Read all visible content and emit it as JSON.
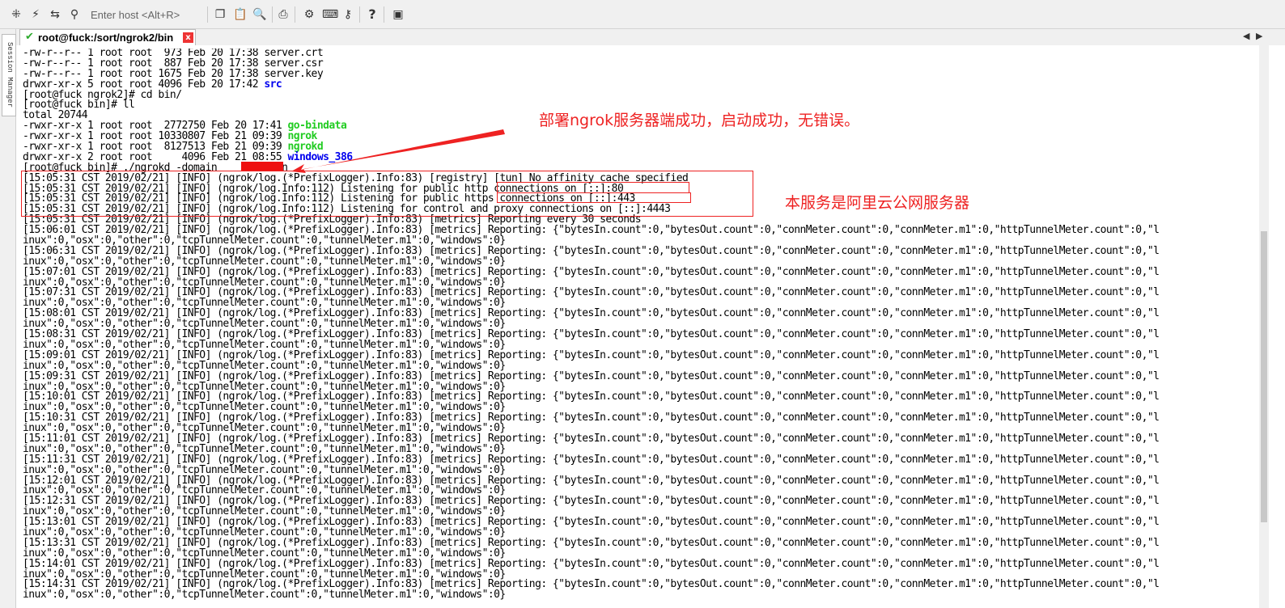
{
  "toolbar": {
    "host_placeholder": "Enter host <Alt+R>",
    "icons": [
      "session-tree-icon",
      "quick-connect-icon",
      "reconnect-icon",
      "connect-icon",
      "copy-icon",
      "paste-icon",
      "find-icon",
      "print-icon",
      "settings-icon",
      "keymap-icon",
      "sftp-icon",
      "help-icon",
      "screenshot-icon"
    ]
  },
  "tab": {
    "title": "root@fuck:/sort/ngrok2/bin",
    "close": "x"
  },
  "sidebar": {
    "label": "Session Manager"
  },
  "terminal": {
    "lines": [
      [
        {
          "t": "-rw-r--r-- 1 root root  973 Feb 20 17:38 server.crt"
        }
      ],
      [
        {
          "t": "-rw-r--r-- 1 root root  887 Feb 20 17:38 server.csr"
        }
      ],
      [
        {
          "t": "-rw-r--r-- 1 root root 1675 Feb 20 17:38 server.key"
        }
      ],
      [
        {
          "t": "drwxr-xr-x 5 root root 4096 Feb 20 17:42 "
        },
        {
          "t": "src",
          "c": "blue"
        }
      ],
      [
        {
          "t": "[root@fuck ngrok2]# cd bin/"
        }
      ],
      [
        {
          "t": "[root@fuck bin]# ll"
        }
      ],
      [
        {
          "t": "total 20744"
        }
      ],
      [
        {
          "t": "-rwxr-xr-x 1 root root  2772750 Feb 20 17:41 "
        },
        {
          "t": "go-bindata",
          "c": "green"
        }
      ],
      [
        {
          "t": "-rwxr-xr-x 1 root root 10330807 Feb 21 09:39 "
        },
        {
          "t": "ngrok",
          "c": "green"
        }
      ],
      [
        {
          "t": "-rwxr-xr-x 1 root root  8127513 Feb 21 09:39 "
        },
        {
          "t": "ngrokd",
          "c": "green"
        }
      ],
      [
        {
          "t": "drwxr-xr-x 2 root root     4096 Feb 21 08:55 "
        },
        {
          "t": "windows_386",
          "c": "blue"
        }
      ],
      [
        {
          "t": "[root@fuck bin]# ./ngrokd -domain         .cn"
        }
      ],
      [
        {
          "t": "[15:05:31 CST 2019/02/21] [INFO] (ngrok/log.(*PrefixLogger).Info:83) [registry] [tun] No affinity cache specified"
        }
      ],
      [
        {
          "t": "[15:05:31 CST 2019/02/21] [INFO] (ngrok/log.Info:112) Listening for public http connections on [::]:80"
        }
      ],
      [
        {
          "t": "[15:05:31 CST 2019/02/21] [INFO] (ngrok/log.Info:112) Listening for public https connections on [::]:443"
        }
      ],
      [
        {
          "t": "[15:05:31 CST 2019/02/21] [INFO] (ngrok/log.Info:112) Listening for control and proxy connections on [::]:4443"
        }
      ],
      [
        {
          "t": "[15:05:31 CST 2019/02/21] [INFO] (ngrok/log.(*PrefixLogger).Info:83) [metrics] Reporting every 30 seconds"
        }
      ],
      [
        {
          "t": "[15:06:01 CST 2019/02/21] [INFO] (ngrok/log.(*PrefixLogger).Info:83) [metrics] Reporting: {\"bytesIn.count\":0,\"bytesOut.count\":0,\"connMeter.count\":0,\"connMeter.m1\":0,\"httpTunnelMeter.count\":0,\"l"
        }
      ],
      [
        {
          "t": "inux\":0,\"osx\":0,\"other\":0,\"tcpTunnelMeter.count\":0,\"tunnelMeter.m1\":0,\"windows\":0}"
        }
      ],
      [
        {
          "t": "[15:06:31 CST 2019/02/21] [INFO] (ngrok/log.(*PrefixLogger).Info:83) [metrics] Reporting: {\"bytesIn.count\":0,\"bytesOut.count\":0,\"connMeter.count\":0,\"connMeter.m1\":0,\"httpTunnelMeter.count\":0,\"l"
        }
      ],
      [
        {
          "t": "inux\":0,\"osx\":0,\"other\":0,\"tcpTunnelMeter.count\":0,\"tunnelMeter.m1\":0,\"windows\":0}"
        }
      ],
      [
        {
          "t": "[15:07:01 CST 2019/02/21] [INFO] (ngrok/log.(*PrefixLogger).Info:83) [metrics] Reporting: {\"bytesIn.count\":0,\"bytesOut.count\":0,\"connMeter.count\":0,\"connMeter.m1\":0,\"httpTunnelMeter.count\":0,\"l"
        }
      ],
      [
        {
          "t": "inux\":0,\"osx\":0,\"other\":0,\"tcpTunnelMeter.count\":0,\"tunnelMeter.m1\":0,\"windows\":0}"
        }
      ],
      [
        {
          "t": "[15:07:31 CST 2019/02/21] [INFO] (ngrok/log.(*PrefixLogger).Info:83) [metrics] Reporting: {\"bytesIn.count\":0,\"bytesOut.count\":0,\"connMeter.count\":0,\"connMeter.m1\":0,\"httpTunnelMeter.count\":0,\"l"
        }
      ],
      [
        {
          "t": "inux\":0,\"osx\":0,\"other\":0,\"tcpTunnelMeter.count\":0,\"tunnelMeter.m1\":0,\"windows\":0}"
        }
      ],
      [
        {
          "t": "[15:08:01 CST 2019/02/21] [INFO] (ngrok/log.(*PrefixLogger).Info:83) [metrics] Reporting: {\"bytesIn.count\":0,\"bytesOut.count\":0,\"connMeter.count\":0,\"connMeter.m1\":0,\"httpTunnelMeter.count\":0,\"l"
        }
      ],
      [
        {
          "t": "inux\":0,\"osx\":0,\"other\":0,\"tcpTunnelMeter.count\":0,\"tunnelMeter.m1\":0,\"windows\":0}"
        }
      ],
      [
        {
          "t": "[15:08:31 CST 2019/02/21] [INFO] (ngrok/log.(*PrefixLogger).Info:83) [metrics] Reporting: {\"bytesIn.count\":0,\"bytesOut.count\":0,\"connMeter.count\":0,\"connMeter.m1\":0,\"httpTunnelMeter.count\":0,\"l"
        }
      ],
      [
        {
          "t": "inux\":0,\"osx\":0,\"other\":0,\"tcpTunnelMeter.count\":0,\"tunnelMeter.m1\":0,\"windows\":0}"
        }
      ],
      [
        {
          "t": "[15:09:01 CST 2019/02/21] [INFO] (ngrok/log.(*PrefixLogger).Info:83) [metrics] Reporting: {\"bytesIn.count\":0,\"bytesOut.count\":0,\"connMeter.count\":0,\"connMeter.m1\":0,\"httpTunnelMeter.count\":0,\"l"
        }
      ],
      [
        {
          "t": "inux\":0,\"osx\":0,\"other\":0,\"tcpTunnelMeter.count\":0,\"tunnelMeter.m1\":0,\"windows\":0}"
        }
      ],
      [
        {
          "t": "[15:09:31 CST 2019/02/21] [INFO] (ngrok/log.(*PrefixLogger).Info:83) [metrics] Reporting: {\"bytesIn.count\":0,\"bytesOut.count\":0,\"connMeter.count\":0,\"connMeter.m1\":0,\"httpTunnelMeter.count\":0,\"l"
        }
      ],
      [
        {
          "t": "inux\":0,\"osx\":0,\"other\":0,\"tcpTunnelMeter.count\":0,\"tunnelMeter.m1\":0,\"windows\":0}"
        }
      ],
      [
        {
          "t": "[15:10:01 CST 2019/02/21] [INFO] (ngrok/log.(*PrefixLogger).Info:83) [metrics] Reporting: {\"bytesIn.count\":0,\"bytesOut.count\":0,\"connMeter.count\":0,\"connMeter.m1\":0,\"httpTunnelMeter.count\":0,\"l"
        }
      ],
      [
        {
          "t": "inux\":0,\"osx\":0,\"other\":0,\"tcpTunnelMeter.count\":0,\"tunnelMeter.m1\":0,\"windows\":0}"
        }
      ],
      [
        {
          "t": "[15:10:31 CST 2019/02/21] [INFO] (ngrok/log.(*PrefixLogger).Info:83) [metrics] Reporting: {\"bytesIn.count\":0,\"bytesOut.count\":0,\"connMeter.count\":0,\"connMeter.m1\":0,\"httpTunnelMeter.count\":0,\"l"
        }
      ],
      [
        {
          "t": "inux\":0,\"osx\":0,\"other\":0,\"tcpTunnelMeter.count\":0,\"tunnelMeter.m1\":0,\"windows\":0}"
        }
      ],
      [
        {
          "t": "[15:11:01 CST 2019/02/21] [INFO] (ngrok/log.(*PrefixLogger).Info:83) [metrics] Reporting: {\"bytesIn.count\":0,\"bytesOut.count\":0,\"connMeter.count\":0,\"connMeter.m1\":0,\"httpTunnelMeter.count\":0,\"l"
        }
      ],
      [
        {
          "t": "inux\":0,\"osx\":0,\"other\":0,\"tcpTunnelMeter.count\":0,\"tunnelMeter.m1\":0,\"windows\":0}"
        }
      ],
      [
        {
          "t": "[15:11:31 CST 2019/02/21] [INFO] (ngrok/log.(*PrefixLogger).Info:83) [metrics] Reporting: {\"bytesIn.count\":0,\"bytesOut.count\":0,\"connMeter.count\":0,\"connMeter.m1\":0,\"httpTunnelMeter.count\":0,\"l"
        }
      ],
      [
        {
          "t": "inux\":0,\"osx\":0,\"other\":0,\"tcpTunnelMeter.count\":0,\"tunnelMeter.m1\":0,\"windows\":0}"
        }
      ],
      [
        {
          "t": "[15:12:01 CST 2019/02/21] [INFO] (ngrok/log.(*PrefixLogger).Info:83) [metrics] Reporting: {\"bytesIn.count\":0,\"bytesOut.count\":0,\"connMeter.count\":0,\"connMeter.m1\":0,\"httpTunnelMeter.count\":0,\"l"
        }
      ],
      [
        {
          "t": "inux\":0,\"osx\":0,\"other\":0,\"tcpTunnelMeter.count\":0,\"tunnelMeter.m1\":0,\"windows\":0}"
        }
      ],
      [
        {
          "t": "[15:12:31 CST 2019/02/21] [INFO] (ngrok/log.(*PrefixLogger).Info:83) [metrics] Reporting: {\"bytesIn.count\":0,\"bytesOut.count\":0,\"connMeter.count\":0,\"connMeter.m1\":0,\"httpTunnelMeter.count\":0,\"l"
        }
      ],
      [
        {
          "t": "inux\":0,\"osx\":0,\"other\":0,\"tcpTunnelMeter.count\":0,\"tunnelMeter.m1\":0,\"windows\":0}"
        }
      ],
      [
        {
          "t": "[15:13:01 CST 2019/02/21] [INFO] (ngrok/log.(*PrefixLogger).Info:83) [metrics] Reporting: {\"bytesIn.count\":0,\"bytesOut.count\":0,\"connMeter.count\":0,\"connMeter.m1\":0,\"httpTunnelMeter.count\":0,\"l"
        }
      ],
      [
        {
          "t": "inux\":0,\"osx\":0,\"other\":0,\"tcpTunnelMeter.count\":0,\"tunnelMeter.m1\":0,\"windows\":0}"
        }
      ],
      [
        {
          "t": "[15:13:31 CST 2019/02/21] [INFO] (ngrok/log.(*PrefixLogger).Info:83) [metrics] Reporting: {\"bytesIn.count\":0,\"bytesOut.count\":0,\"connMeter.count\":0,\"connMeter.m1\":0,\"httpTunnelMeter.count\":0,\"l"
        }
      ],
      [
        {
          "t": "inux\":0,\"osx\":0,\"other\":0,\"tcpTunnelMeter.count\":0,\"tunnelMeter.m1\":0,\"windows\":0}"
        }
      ],
      [
        {
          "t": "[15:14:01 CST 2019/02/21] [INFO] (ngrok/log.(*PrefixLogger).Info:83) [metrics] Reporting: {\"bytesIn.count\":0,\"bytesOut.count\":0,\"connMeter.count\":0,\"connMeter.m1\":0,\"httpTunnelMeter.count\":0,\"l"
        }
      ],
      [
        {
          "t": "inux\":0,\"osx\":0,\"other\":0,\"tcpTunnelMeter.count\":0,\"tunnelMeter.m1\":0,\"windows\":0}"
        }
      ],
      [
        {
          "t": "[15:14:31 CST 2019/02/21] [INFO] (ngrok/log.(*PrefixLogger).Info:83) [metrics] Reporting: {\"bytesIn.count\":0,\"bytesOut.count\":0,\"connMeter.count\":0,\"connMeter.m1\":0,\"httpTunnelMeter.count\":0,\"l"
        }
      ],
      [
        {
          "t": "inux\":0,\"osx\":0,\"other\":0,\"tcpTunnelMeter.count\":0,\"tunnelMeter.m1\":0,\"windows\":0}"
        }
      ]
    ]
  },
  "annotations": {
    "note1": "部署ngrok服务器端成功，启动成功，无错误。",
    "note2": "本服务是阿里云公网服务器"
  },
  "colors": {
    "annotation": "#ee2222",
    "dir": "#0000ee",
    "exec": "#22cc22",
    "tab_check": "#2eaa2e"
  }
}
